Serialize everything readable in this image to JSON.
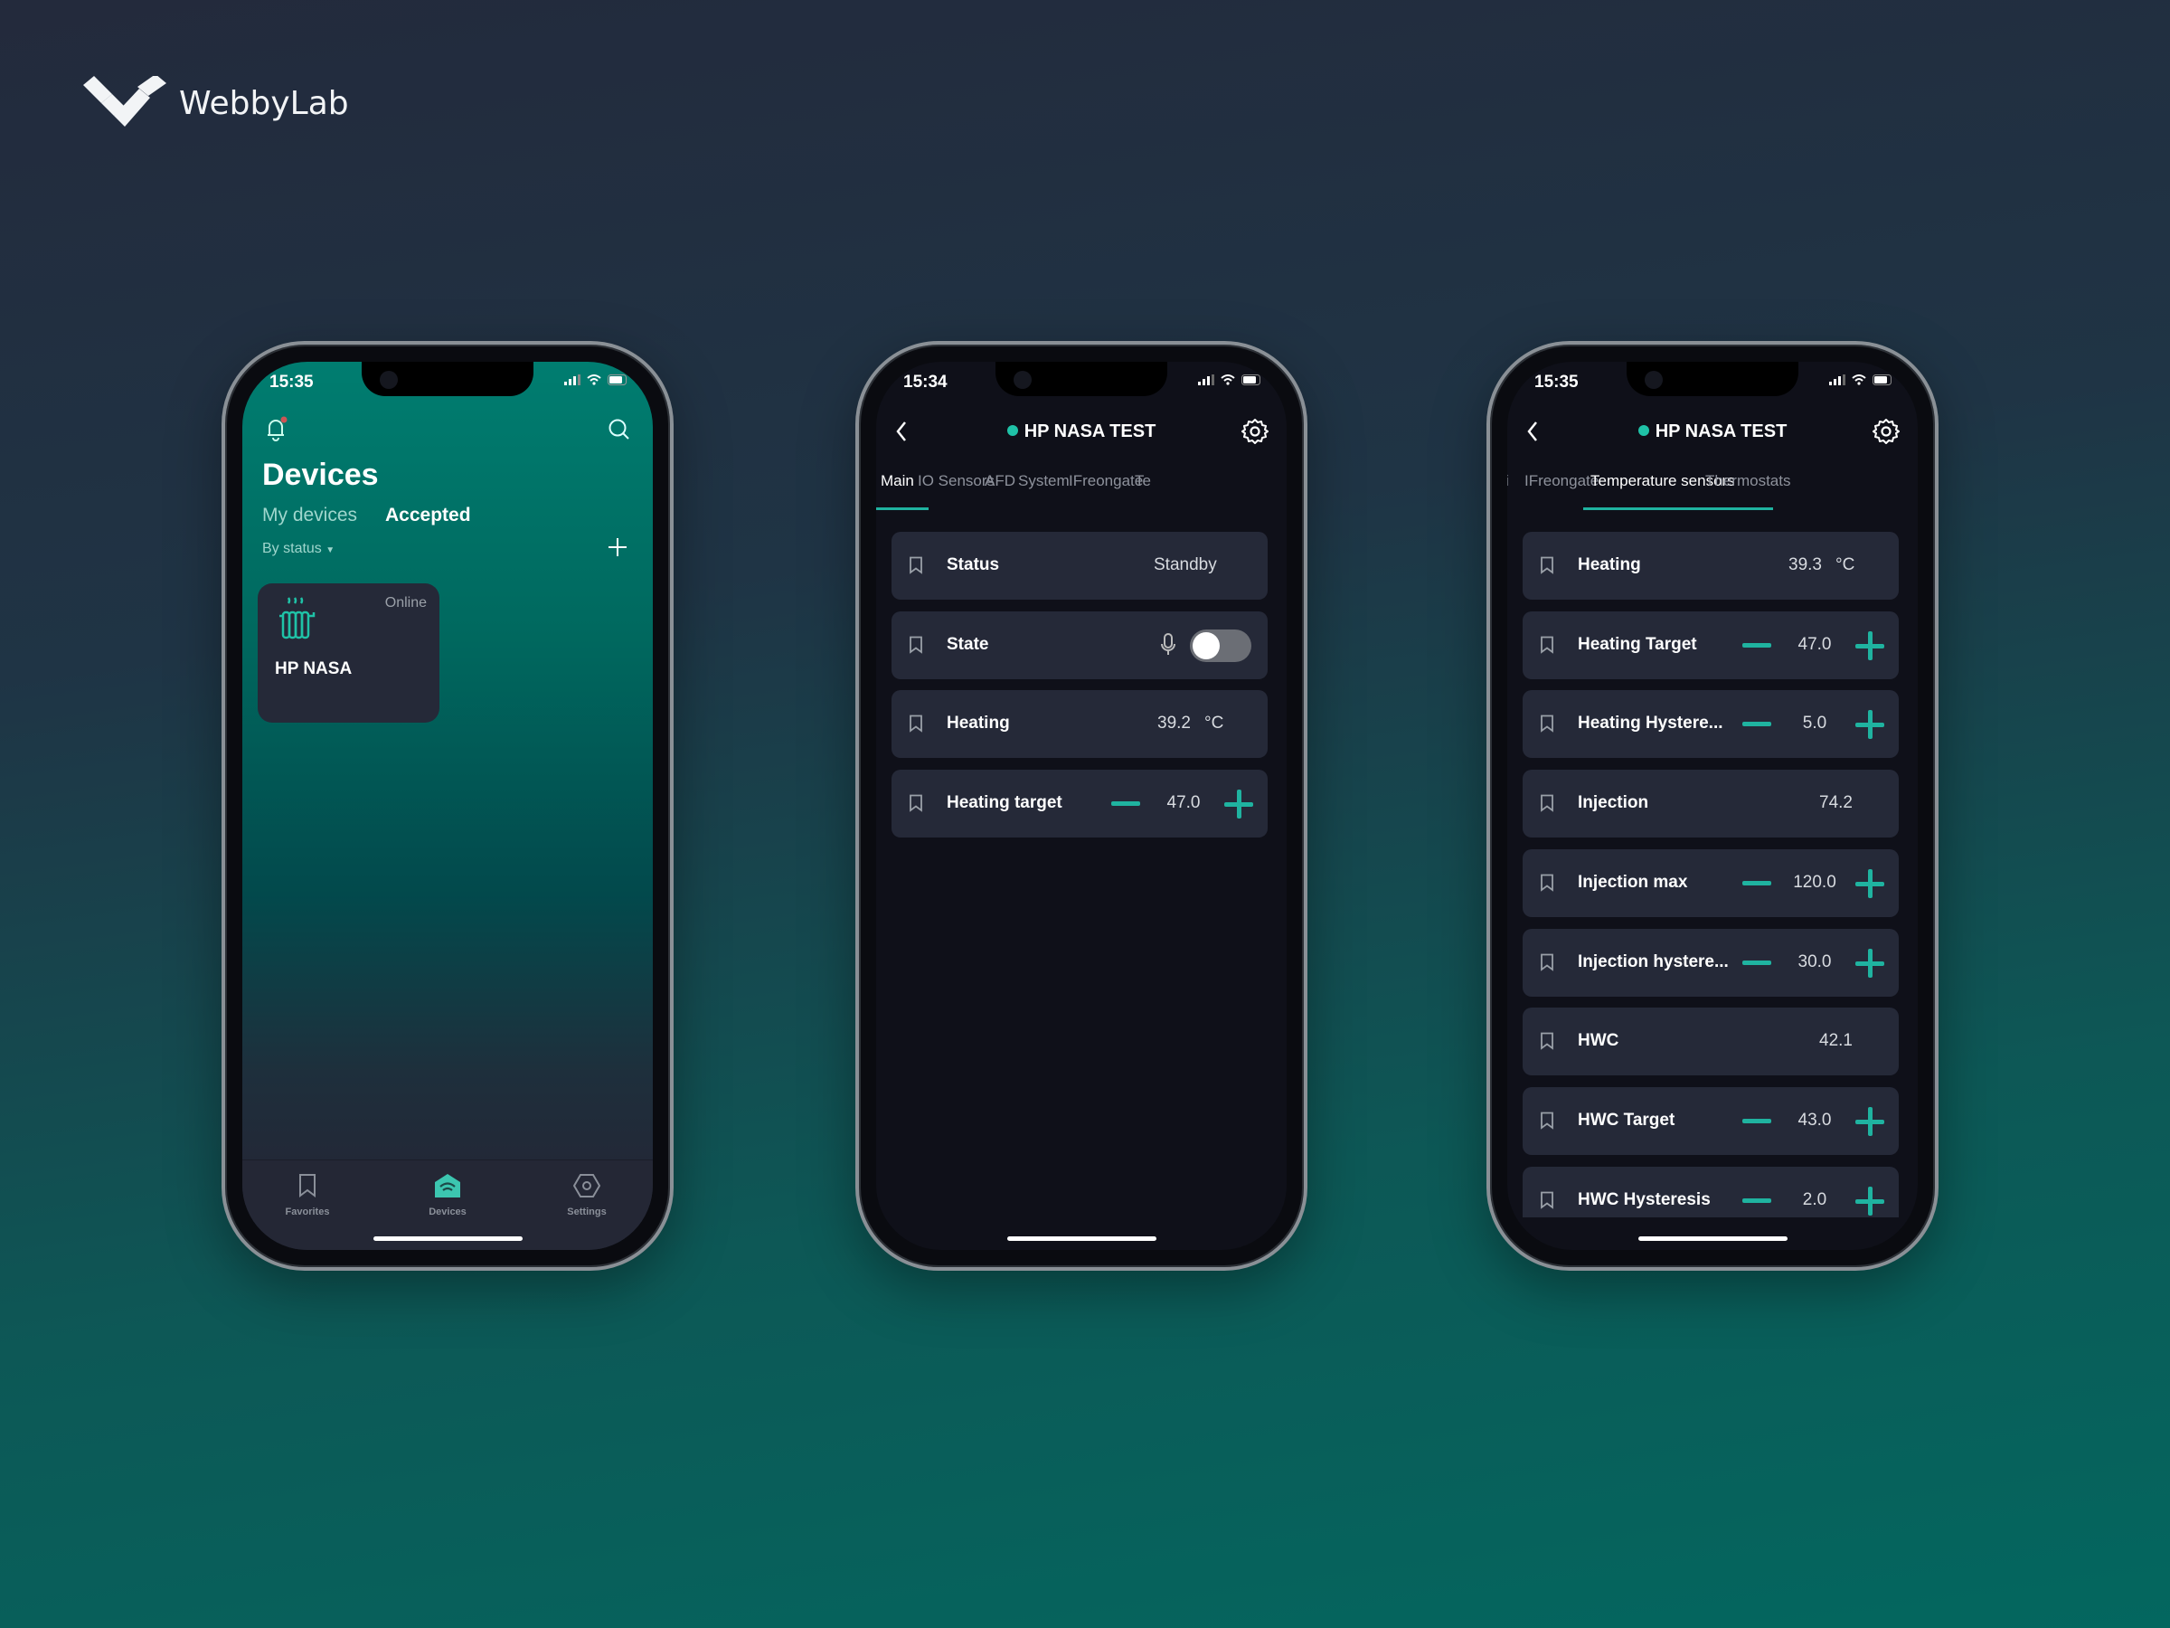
{
  "brand": {
    "name": "WebbyLab"
  },
  "colors": {
    "accent": "#1fb3a0",
    "card": "#252938",
    "screen_bg": "#0f1019",
    "teal_top": "#007d70"
  },
  "phone1": {
    "time": "15:35",
    "title": "Devices",
    "tabs": [
      {
        "label": "My devices",
        "active": false
      },
      {
        "label": "Accepted",
        "active": true
      }
    ],
    "filter": "By status",
    "device": {
      "name": "HP NASA",
      "status": "Online",
      "icon": "radiator-icon"
    },
    "nav": [
      {
        "label": "Favorites",
        "icon": "bookmark-icon",
        "active": false
      },
      {
        "label": "Devices",
        "icon": "home-wifi-icon",
        "active": true
      },
      {
        "label": "Settings",
        "icon": "settings-hex-icon",
        "active": false
      }
    ]
  },
  "phone2": {
    "time": "15:34",
    "title": "HP NASA TEST",
    "tabs": [
      {
        "label": "Main",
        "active": true
      },
      {
        "label": "IO Sensors"
      },
      {
        "label": "AFD"
      },
      {
        "label": "System"
      },
      {
        "label": "IFreongate"
      },
      {
        "label": "Te"
      }
    ],
    "rows": [
      {
        "type": "value",
        "label": "Status",
        "value": "Standby"
      },
      {
        "type": "toggle",
        "label": "State",
        "on": false
      },
      {
        "type": "value",
        "label": "Heating",
        "value": "39.2",
        "unit": "°C"
      },
      {
        "type": "stepper",
        "label": "Heating target",
        "value": "47.0"
      }
    ]
  },
  "phone3": {
    "time": "15:35",
    "title": "HP NASA TEST",
    "tabs": [
      {
        "label": "i"
      },
      {
        "label": "IFreongate"
      },
      {
        "label": "Temperature sensors",
        "active": true
      },
      {
        "label": "Thermostats"
      }
    ],
    "rows": [
      {
        "type": "value",
        "label": "Heating",
        "value": "39.3",
        "unit": "°C"
      },
      {
        "type": "stepper",
        "label": "Heating Target",
        "value": "47.0"
      },
      {
        "type": "stepper",
        "label": "Heating Hystere...",
        "value": "5.0"
      },
      {
        "type": "value",
        "label": "Injection",
        "value": "74.2"
      },
      {
        "type": "stepper",
        "label": "Injection max",
        "value": "120.0"
      },
      {
        "type": "stepper",
        "label": "Injection hystere...",
        "value": "30.0"
      },
      {
        "type": "value",
        "label": "HWC",
        "value": "42.1"
      },
      {
        "type": "stepper",
        "label": "HWC Target",
        "value": "43.0"
      },
      {
        "type": "stepper",
        "label": "HWC Hysteresis",
        "value": "2.0"
      }
    ]
  }
}
